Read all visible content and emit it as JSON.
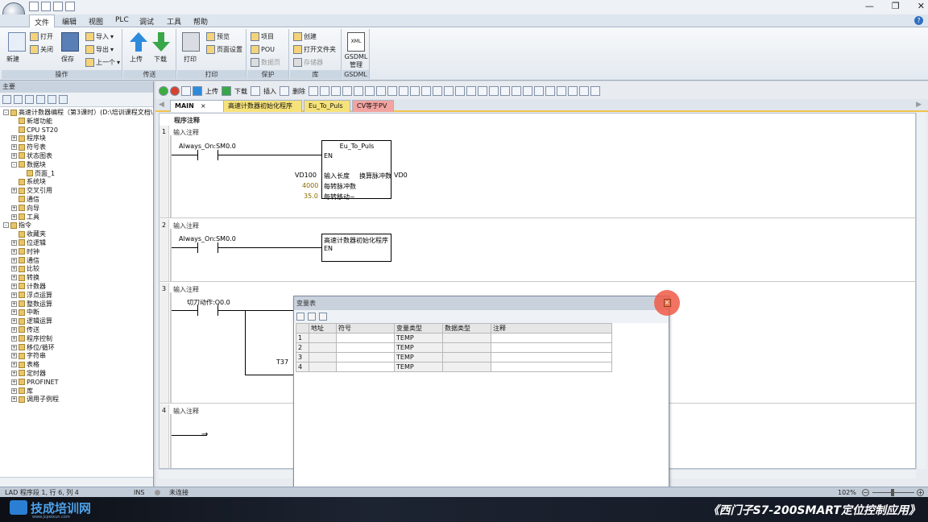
{
  "menu": {
    "items": [
      "文件",
      "编辑",
      "视图",
      "PLC",
      "调试",
      "工具",
      "帮助"
    ],
    "active": "文件"
  },
  "ribbon": {
    "groups": [
      {
        "label": "操作",
        "buttons": [
          "新建",
          "打开",
          "关闭",
          "保存",
          "导入",
          "导出",
          "上一个"
        ]
      },
      {
        "label": "传送",
        "buttons": [
          "上传",
          "下载"
        ]
      },
      {
        "label": "打印",
        "buttons": [
          "打印",
          "预览",
          "页面设置"
        ]
      },
      {
        "label": "保护",
        "buttons": [
          "项目",
          "POU",
          "数据页"
        ]
      },
      {
        "label": "库",
        "buttons": [
          "创建",
          "打开文件夹",
          "存储器"
        ]
      },
      {
        "label": "GSDML",
        "buttons": [
          "GSDML 管理"
        ]
      }
    ]
  },
  "left": {
    "header": "主要",
    "tree": [
      {
        "text": "高速计数器编程（第3课时）(D:\\培训课程文档\\1",
        "level": 0,
        "pm": "-"
      },
      {
        "text": "新增功能",
        "level": 1,
        "pm": ""
      },
      {
        "text": "CPU ST20",
        "level": 1,
        "pm": ""
      },
      {
        "text": "程序块",
        "level": 1,
        "pm": "+"
      },
      {
        "text": "符号表",
        "level": 1,
        "pm": "+"
      },
      {
        "text": "状态图表",
        "level": 1,
        "pm": "+"
      },
      {
        "text": "数据块",
        "level": 1,
        "pm": "-"
      },
      {
        "text": "页面_1",
        "level": 2,
        "pm": ""
      },
      {
        "text": "系统块",
        "level": 1,
        "pm": ""
      },
      {
        "text": "交叉引用",
        "level": 1,
        "pm": "+"
      },
      {
        "text": "通信",
        "level": 1,
        "pm": ""
      },
      {
        "text": "向导",
        "level": 1,
        "pm": "+"
      },
      {
        "text": "工具",
        "level": 1,
        "pm": "+"
      },
      {
        "text": "指令",
        "level": 0,
        "pm": "-"
      },
      {
        "text": "收藏夹",
        "level": 1,
        "pm": ""
      },
      {
        "text": "位逻辑",
        "level": 1,
        "pm": "+"
      },
      {
        "text": "时钟",
        "level": 1,
        "pm": "+"
      },
      {
        "text": "通信",
        "level": 1,
        "pm": "+"
      },
      {
        "text": "比较",
        "level": 1,
        "pm": "+"
      },
      {
        "text": "转换",
        "level": 1,
        "pm": "+"
      },
      {
        "text": "计数器",
        "level": 1,
        "pm": "+"
      },
      {
        "text": "浮点运算",
        "level": 1,
        "pm": "+"
      },
      {
        "text": "整数运算",
        "level": 1,
        "pm": "+"
      },
      {
        "text": "中断",
        "level": 1,
        "pm": "+"
      },
      {
        "text": "逻辑运算",
        "level": 1,
        "pm": "+"
      },
      {
        "text": "传送",
        "level": 1,
        "pm": "+"
      },
      {
        "text": "程序控制",
        "level": 1,
        "pm": "+"
      },
      {
        "text": "移位/循环",
        "level": 1,
        "pm": "+"
      },
      {
        "text": "字符串",
        "level": 1,
        "pm": "+"
      },
      {
        "text": "表格",
        "level": 1,
        "pm": "+"
      },
      {
        "text": "定时器",
        "level": 1,
        "pm": "+"
      },
      {
        "text": "PROFINET",
        "level": 1,
        "pm": "+"
      },
      {
        "text": "库",
        "level": 1,
        "pm": "+"
      },
      {
        "text": "调用子例程",
        "level": 1,
        "pm": "+"
      }
    ]
  },
  "toolbar": {
    "upload": "上传",
    "download": "下载",
    "insert": "插入",
    "delete": "删除"
  },
  "tabs": [
    {
      "label": "MAIN",
      "bg": "#ffffff"
    },
    {
      "label": "高速计数器初始化程序",
      "bg": "#f6e27a"
    },
    {
      "label": "Eu_To_Puls",
      "bg": "#f6e27a"
    },
    {
      "label": "CV等于PV",
      "bg": "#f3a3a0"
    }
  ],
  "editor": {
    "program_comment": "程序注释",
    "networks": [
      {
        "num": "1",
        "comment": "输入注释",
        "contact": "Always_On:SM0.0",
        "block": "Eu_To_Puls",
        "en": "EN",
        "inputs": [
          {
            "val": "VD100",
            "pin": "输入长度"
          },
          {
            "val": "4000",
            "pin": "每转脉冲数"
          },
          {
            "val": "35.0",
            "pin": "每转移动~"
          }
        ],
        "output_pin": "换算脉冲数",
        "output_val": "VD0"
      },
      {
        "num": "2",
        "comment": "输入注释",
        "contact": "Always_On:SM0.0",
        "block": "高速计数器初始化程序",
        "en": "EN"
      },
      {
        "num": "3",
        "comment": "输入注释",
        "contact": "切刀动作:Q0.0",
        "timer": "T37"
      },
      {
        "num": "4",
        "comment": "输入注释"
      }
    ]
  },
  "var_table": {
    "title": "变量表",
    "headers": [
      "",
      "地址",
      "符号",
      "变量类型",
      "数据类型",
      "注释"
    ],
    "rows": [
      [
        "1",
        "",
        "",
        "TEMP",
        "",
        ""
      ],
      [
        "2",
        "",
        "",
        "TEMP",
        "",
        ""
      ],
      [
        "3",
        "",
        "",
        "TEMP",
        "",
        ""
      ],
      [
        "4",
        "",
        "",
        "TEMP",
        "",
        ""
      ]
    ]
  },
  "status": {
    "mode": "LAD 程序段 1, 行 6, 列 4",
    "ins": "INS",
    "connection": "未连接",
    "zoom": "102%"
  },
  "footer": {
    "logo": "技成培训网",
    "logo_sub": "www.jcpeixun.com",
    "title": "《西门子S7-200SMART定位控制应用》"
  }
}
